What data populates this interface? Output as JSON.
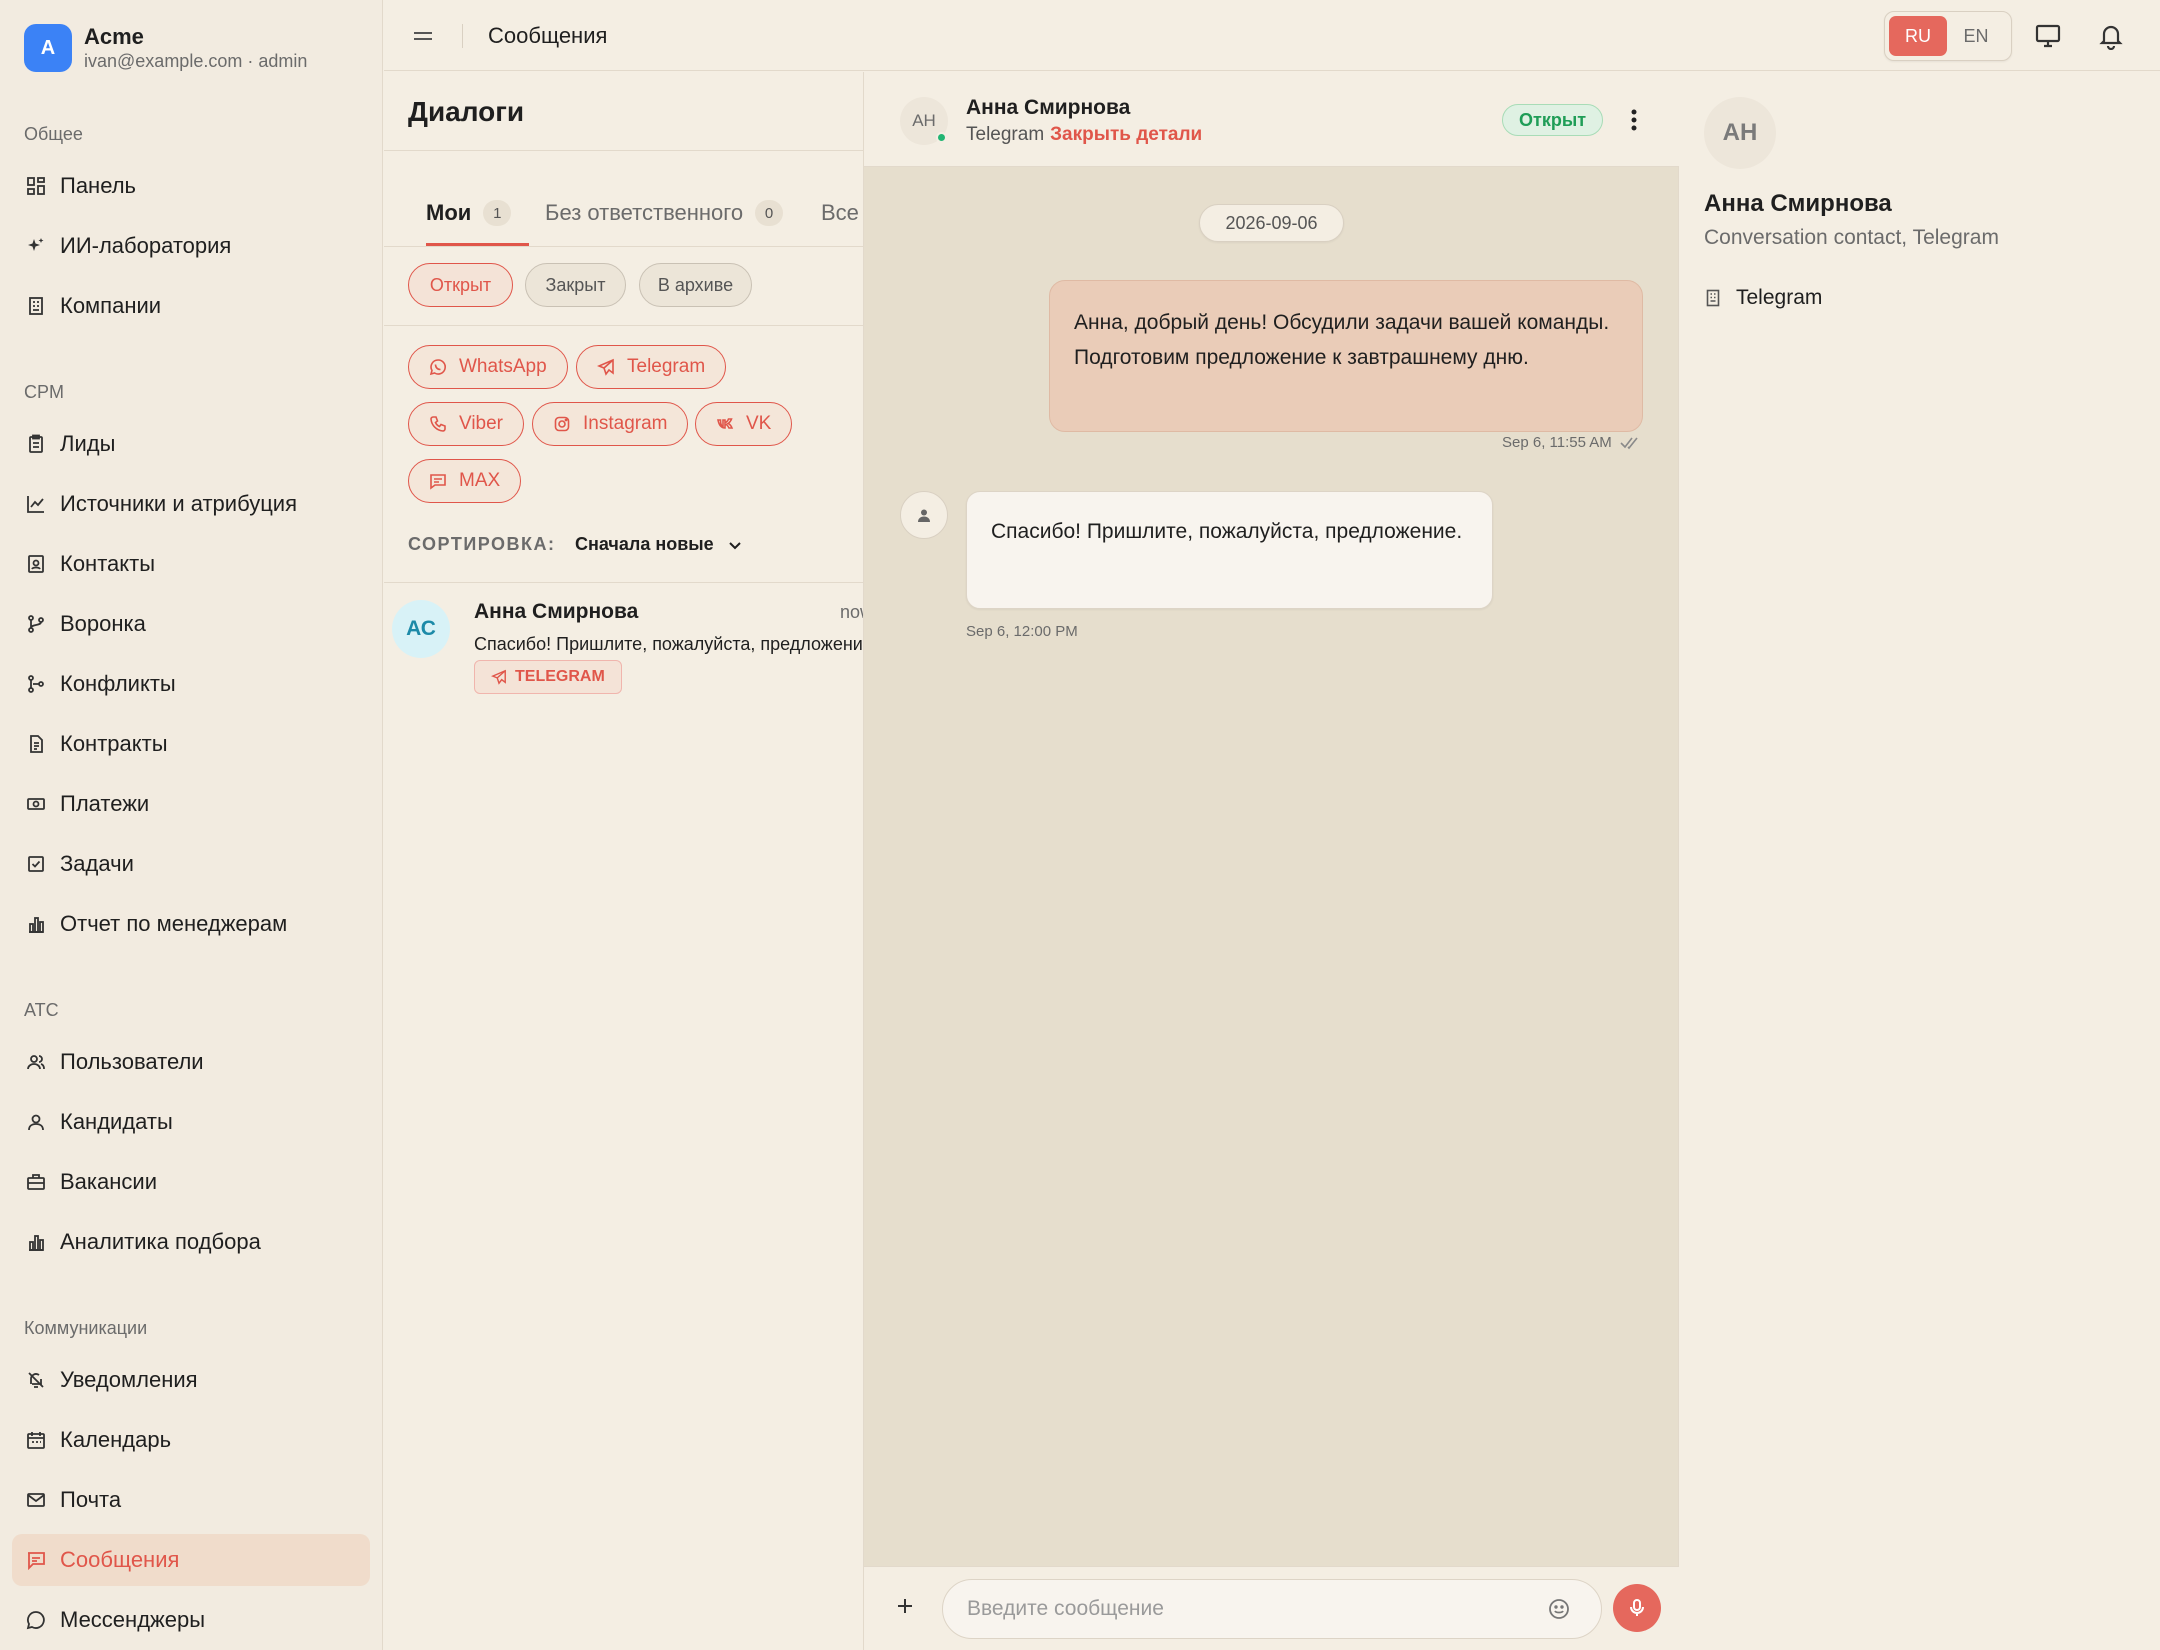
{
  "brand": {
    "logo_letter": "A",
    "name": "Acme",
    "subtitle": "ivan@example.com · admin"
  },
  "sidebar": {
    "sections": {
      "general": "Общее",
      "crm": "CPM",
      "ats": "ATC",
      "comms": "Коммуникации"
    },
    "items": [
      {
        "label": "Панель",
        "icon": "dashboard-icon"
      },
      {
        "label": "ИИ-лаборатория",
        "icon": "sparkles-icon"
      },
      {
        "label": "Компании",
        "icon": "building-icon"
      },
      {
        "label": "Лиды",
        "icon": "clipboard-icon"
      },
      {
        "label": "Источники и атрибуция",
        "icon": "line-chart-icon"
      },
      {
        "label": "Контакты",
        "icon": "contact-card-icon"
      },
      {
        "label": "Воронка",
        "icon": "funnel-icon"
      },
      {
        "label": "Конфликты",
        "icon": "git-branch-icon"
      },
      {
        "label": "Контракты",
        "icon": "document-icon"
      },
      {
        "label": "Платежи",
        "icon": "banknote-icon"
      },
      {
        "label": "Задачи",
        "icon": "checkbox-icon"
      },
      {
        "label": "Отчет по менеджерам",
        "icon": "bar-chart-icon"
      },
      {
        "label": "Пользователи",
        "icon": "users-icon"
      },
      {
        "label": "Кандидаты",
        "icon": "user-icon"
      },
      {
        "label": "Вакансии",
        "icon": "briefcase-icon"
      },
      {
        "label": "Аналитика подбора",
        "icon": "bar-chart-icon"
      },
      {
        "label": "Уведомления",
        "icon": "bell-off-icon"
      },
      {
        "label": "Календарь",
        "icon": "calendar-icon"
      },
      {
        "label": "Почта",
        "icon": "mail-icon"
      },
      {
        "label": "Сообщения",
        "icon": "message-square-icon",
        "active": true
      },
      {
        "label": "Мессенджеры",
        "icon": "message-circle-icon"
      }
    ]
  },
  "topbar": {
    "title": "Сообщения",
    "lang": {
      "ru": "RU",
      "en": "EN",
      "active": "RU"
    }
  },
  "dialogs": {
    "title": "Диалоги",
    "tabs": [
      {
        "label": "Мои",
        "count": "1",
        "active": true
      },
      {
        "label": "Без ответственного",
        "count": "0"
      },
      {
        "label": "Все"
      }
    ],
    "status_filters": [
      "Открыт",
      "Закрыт",
      "В архиве"
    ],
    "active_status": "Открыт",
    "channels": [
      "WhatsApp",
      "Telegram",
      "Viber",
      "Instagram",
      "VK",
      "MAX"
    ],
    "sort_label": "СОРТИРОВКА:",
    "sort_value": "Сначала новые",
    "conversations": [
      {
        "initials": "АС",
        "name": "Анна Смирнова",
        "time": "now",
        "preview": "Спасибо! Пришлите, пожалуйста, предложение.",
        "channel": "TELEGRAM"
      }
    ]
  },
  "chat": {
    "initials": "АН",
    "name": "Анна Смирнова",
    "channel": "Telegram",
    "close_details": "Закрыть детали",
    "status": "Открыт",
    "date": "2026-09-06",
    "messages": [
      {
        "direction": "out",
        "text": "Анна, добрый день! Обсудили задачи вашей команды. Подготовим предложение к завтрашнему дню.",
        "time": "Sep 6, 11:55 AM"
      },
      {
        "direction": "in",
        "text": "Спасибо! Пришлите, пожалуйста, предложение.",
        "time": "Sep 6, 12:00 PM"
      }
    ],
    "composer_placeholder": "Введите сообщение"
  },
  "contact": {
    "initials": "АН",
    "name": "Анна Смирнова",
    "subtitle": "Conversation contact, Telegram",
    "channel": "Telegram"
  },
  "colors": {
    "accent": "#e0564a",
    "background": "#f4eee3",
    "chat_background": "#e6decd",
    "outgoing_bubble": "#eaccb8",
    "status_green": "#1f9d57"
  }
}
